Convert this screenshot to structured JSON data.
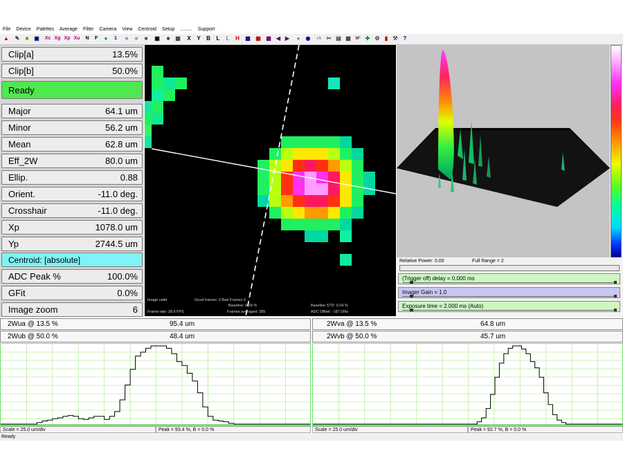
{
  "menu": [
    "File",
    "Device",
    "Palettes",
    "Average",
    "Filter",
    "Camera",
    "View",
    "Centroid",
    "Setup",
    ".........",
    "Support"
  ],
  "toolbar_glyphs": [
    "Xc",
    "Xg",
    "Xp",
    "Xu",
    "N",
    "F",
    "1",
    "X",
    "Y",
    "B",
    "L",
    "L",
    "H"
  ],
  "colors": {
    "accent_green": "#4ee94e",
    "accent_cyan": "#7ff3f6",
    "grid_green": "#b6ef9a",
    "slider_green": "#ccf7c2",
    "slider_lavender": "#c8c8f2"
  },
  "results": [
    {
      "label": "Clip[a]",
      "value": "13.5%"
    },
    {
      "label": "Clip[b]",
      "value": "50.0%"
    },
    {
      "label": "Ready",
      "value": ""
    },
    {
      "label": "Major",
      "value": "64.1 um"
    },
    {
      "label": "Minor",
      "value": "56.2 um"
    },
    {
      "label": "Mean",
      "value": "62.8 um"
    },
    {
      "label": "Eff_2W",
      "value": "80.0 um"
    },
    {
      "label": "Ellip.",
      "value": "0.88"
    },
    {
      "label": "Orient.",
      "value": "-11.0 deg."
    },
    {
      "label": "Crosshair",
      "value": "-11.0 deg."
    },
    {
      "label": "Xp",
      "value": "1078.0 um"
    },
    {
      "label": "Yp",
      "value": "2744.5 um"
    },
    {
      "label": "Centroid: [absolute]",
      "value": ""
    },
    {
      "label": "ADC Peak %",
      "value": "100.0%"
    },
    {
      "label": "GFit",
      "value": "0.0%"
    },
    {
      "label": "Image zoom",
      "value": "6"
    }
  ],
  "beam_status": {
    "image_valid": "Image valid",
    "good_bad": "Good frames: 0 Bad Frames 0",
    "baseline": "Baseline: 0.29 %",
    "baseline_std": "Baseline STD: 0.04 %",
    "frame_rate": "Frame rate: 28.6 FPS",
    "frames_averaged": "Frames averaged: 385",
    "adc_offset": "ADC Offset: -187 DNs"
  },
  "controls": {
    "relative_power": "Relative Power: 0.00",
    "full_range": "Full Range = 2",
    "trigger": "(Trigger off) delay = 0.000 ms",
    "gain": "Imager Gain = 1.0",
    "exposure": "Exposure time = 2.000 ms (Auto)"
  },
  "summary": [
    {
      "label": "2Wua @ 13.5 %",
      "value": "95.4 um"
    },
    {
      "label": "2Wva @ 13.5 %",
      "value": "64.8 um"
    },
    {
      "label": "2Wub @ 50.0 %",
      "value": "48.4 um"
    },
    {
      "label": "2Wvb @ 50.0 %",
      "value": "45.7 um"
    }
  ],
  "profiles": [
    {
      "scale": "Scale = 25.0 um/div",
      "peak": "Peak = 93.4 %,  B = 0.0 %",
      "levels": [
        0,
        0,
        0,
        0,
        0,
        0,
        0,
        2,
        4,
        5,
        7,
        8,
        10,
        11,
        10,
        7,
        6,
        8,
        10,
        10,
        6,
        10,
        16,
        31,
        50,
        70,
        87,
        92,
        97,
        100,
        100,
        100,
        97,
        90,
        80,
        75,
        65,
        55,
        40,
        22,
        10,
        5,
        4,
        3,
        1,
        0,
        0,
        0,
        0,
        0,
        0,
        0,
        0,
        0,
        0,
        0,
        0,
        0,
        0,
        0
      ]
    },
    {
      "scale": "Scale = 25.0 um/div",
      "peak": "Peak = 92.7 %,  B = 0.0 %",
      "levels": [
        0,
        0,
        0,
        0,
        0,
        0,
        0,
        0,
        0,
        0,
        0,
        0,
        0,
        0,
        0,
        0,
        0,
        0,
        0,
        0,
        0,
        0,
        0,
        0,
        0,
        0,
        0,
        0,
        0,
        0,
        0,
        0,
        0,
        0,
        0,
        0,
        0,
        3,
        8,
        20,
        38,
        60,
        78,
        90,
        97,
        100,
        100,
        96,
        90,
        80,
        72,
        60,
        40,
        25,
        12,
        5,
        2,
        0,
        0,
        0,
        0,
        0,
        0,
        0,
        0,
        0,
        0,
        0,
        0,
        0
      ]
    }
  ],
  "status_text": "Ready"
}
